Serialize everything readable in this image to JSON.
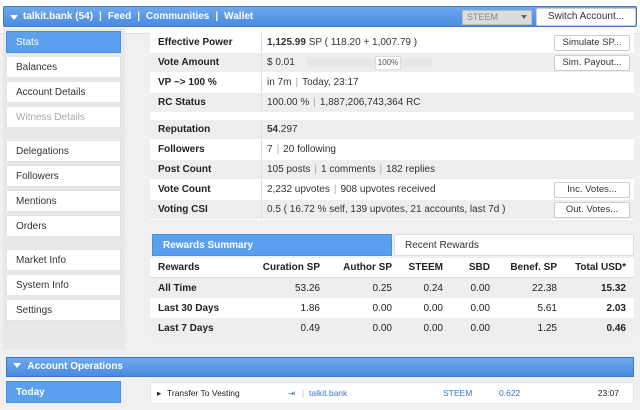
{
  "header": {
    "account": "talkit.bank (54)",
    "nav": [
      "Feed",
      "Communities",
      "Wallet"
    ],
    "currency_select": "STEEM",
    "switch_button": "Switch Account..."
  },
  "sidebar": {
    "groups": [
      [
        {
          "label": "Stats",
          "state": "active"
        },
        {
          "label": "Balances"
        },
        {
          "label": "Account Details"
        },
        {
          "label": "Witness Details",
          "state": "disabled"
        }
      ],
      [
        {
          "label": "Delegations"
        },
        {
          "label": "Followers"
        },
        {
          "label": "Mentions"
        },
        {
          "label": "Orders"
        }
      ],
      [
        {
          "label": "Market Info"
        },
        {
          "label": "System Info"
        },
        {
          "label": "Settings"
        }
      ]
    ]
  },
  "stats": {
    "effective_power": {
      "label": "Effective Power",
      "value": "1,125.99",
      "unit": "SP",
      "detail": "( 118.20 + 1,007.79 )",
      "button": "Simulate SP..."
    },
    "vote_amount": {
      "label": "Vote Amount",
      "value": "$ 0.01",
      "slider_pct": "100%",
      "button": "Sim. Payout..."
    },
    "vp": {
      "label": "VP ~> 100 %",
      "in": "in 7m",
      "when": "Today, 23:17"
    },
    "rc_status": {
      "label": "RC Status",
      "pct": "100.00 %",
      "rc": "1,887,206,743,364 RC"
    },
    "reputation": {
      "label": "Reputation",
      "bold": "54",
      "rest": ".297"
    },
    "followers": {
      "label": "Followers",
      "count": "7",
      "following": "20 following"
    },
    "post_count": {
      "label": "Post Count",
      "posts": "105 posts",
      "comments": "1 comments",
      "replies": "182 replies"
    },
    "vote_count": {
      "label": "Vote Count",
      "upvotes": "2,232 upvotes",
      "received": "908 upvotes received",
      "button": "Inc. Votes..."
    },
    "voting_csi": {
      "label": "Voting CSI",
      "value": "0.5 ( 16.72 % self, 139 upvotes, 21 accounts, last 7d )",
      "button": "Out. Votes..."
    }
  },
  "rewards": {
    "tabs": [
      "Rewards Summary",
      "Recent Rewards"
    ],
    "headers": [
      "Rewards",
      "Curation SP",
      "Author SP",
      "STEEM",
      "SBD",
      "Benef. SP",
      "Total USD*"
    ],
    "rows": [
      [
        "All Time",
        "53.26",
        "0.25",
        "0.24",
        "0.00",
        "22.38",
        "15.32"
      ],
      [
        "Last 30 Days",
        "1.86",
        "0.00",
        "0.00",
        "0.00",
        "5.61",
        "2.03"
      ],
      [
        "Last 7 Days",
        "0.49",
        "0.00",
        "0.00",
        "0.00",
        "1.25",
        "0.46"
      ]
    ]
  },
  "operations": {
    "title": "Account Operations",
    "today": "Today",
    "tx": {
      "type": "Transfer To Vesting",
      "to": "talkit.bank",
      "asset": "STEEM",
      "amount": "0.622",
      "time": "23:07"
    }
  }
}
